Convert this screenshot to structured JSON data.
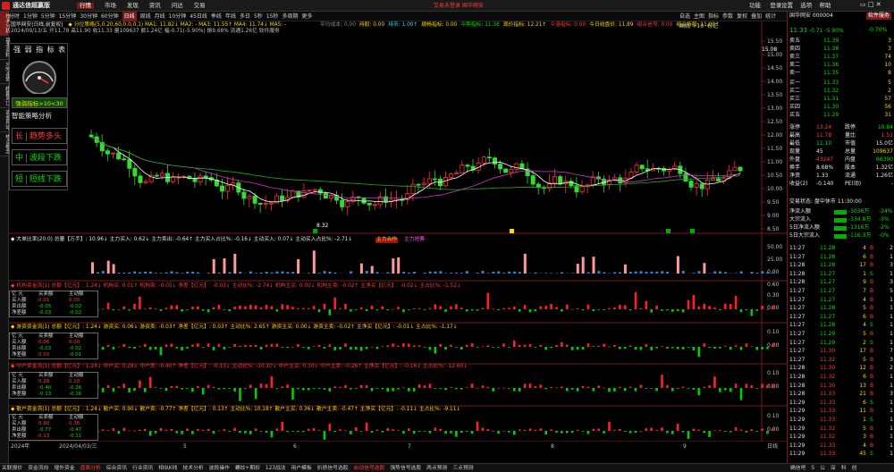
{
  "app": {
    "name": "通达信超赢版",
    "menu": [
      "行情",
      "市场",
      "发现",
      "资讯",
      "问达",
      "交易"
    ],
    "center_notice": "交易未登录  国华网安",
    "right_menu": [
      "功能",
      "登录"
    ],
    "right_menu2": [
      "设置",
      "选项",
      "帮助"
    ]
  },
  "toolbar": [
    "分时",
    "1分钟",
    "5分钟",
    "15分钟",
    "30分钟",
    "60分钟",
    "日线",
    "周线",
    "月线",
    "10分钟",
    "45日线",
    "季线",
    "年线",
    "多日",
    "5秒",
    "15秒",
    "多周期",
    "更多"
  ],
  "toolbar_right": [
    "自选",
    "主图",
    "指标",
    "参数",
    "复权",
    "叠加",
    "统计",
    "画线",
    "F10",
    "标记"
  ],
  "sidebar_tabs": [
    "技术分析",
    "基本资料",
    "分时走势",
    "超赢风口",
    "资金异动",
    "热点概念"
  ],
  "header": {
    "title": "国华网安(日线,前复权)",
    "indicator": "◆ 分位策略(5,0.20,60,0.0,0,1) MA1: 11.82↓ MA2: - MA3: 11.55↑ MA4: 11.74↓ MA5: -",
    "date_line": "2024/09/13/五 开11.78 高11.90 收11.33 量109637 额1.24亿 幅-0.71(-5.90%) 振9.68% 流通1.26亿 软件服务",
    "extra_info": [
      "平均成本: 0.00",
      "持股: 0.00",
      "持币: 1.00↑",
      "顺畅指标: 0.00",
      "今期指标: 11.38",
      "现价指标: 12.21↑",
      "今港指标: 0.00",
      "今日收盘价: 11.89",
      "组合信号: 0.00",
      "组合持股: 11.00↑"
    ]
  },
  "y_axis": [
    "15.50",
    "15.00",
    "14.50",
    "14.00",
    "13.50",
    "13.00",
    "12.50",
    "12.00",
    "11.50",
    "11.00",
    "10.50",
    "10.00",
    "9.50",
    "9.00",
    "8.50"
  ],
  "y_flag": "15.08",
  "low_label": "8.32",
  "strong_panel": {
    "title": "强 弱 指 标 表",
    "condition": "强弱指标>10<30",
    "strategy": "智能策略分析",
    "rows": [
      {
        "tag": "长",
        "text": "趋势多头"
      },
      {
        "tag": "中",
        "text": "波段下跌"
      },
      {
        "tag": "短",
        "text": "短线下跌"
      }
    ]
  },
  "panel1": {
    "text": "◆ 大单比率(20.0) 总量【万手】: 10.96↓ 主力买入: 0.62↓ 主力卖出: -0.64↑ 主力买入占比%: -0.16↓ 主动买入: 0.07↓ 主动买入占比%: -2.71↓",
    "ticks": [
      "50.00",
      "25.00",
      "0.00"
    ],
    "hl": "主力合作",
    "hl2": "主力抢筹"
  },
  "panel2": {
    "text": "◆ 机构资金流(1) 总额【亿元】: 1.24↓ 机构买: 0.01↑ 机构卖: -0.05↓ 净差【亿元】: -0.03↓ 主动比%: -2.74↓ 机构主买: 0.00↓ 机构主卖: -0.02↑ 主净买【亿元】: -0.02↓ 主占比%: -1.52↓",
    "ticks": [
      "0.60",
      "0.30",
      "0.00"
    ],
    "box": [
      [
        "亿 元",
        "买卖额",
        "主动额"
      ],
      [
        "买入额",
        "0.01",
        "0.00"
      ],
      [
        "卖出额",
        "-0.05",
        "-0.02"
      ],
      [
        "净差额",
        "-0.03",
        "-0.02"
      ]
    ]
  },
  "panel3": {
    "text": "◆ 游资资金流(1) 总额【亿元】: 1.24↓ 游资买: 0.06↓ 游资卖: -0.03↑ 净差【亿元】: 0.03↑ 主动比%: 2.65↑ 游资主买: 0.00↓ 游资主卖: -0.02↑ 主净买【亿元】: -0.01↓ 主占比%: -1.17↓",
    "ticks": [
      "0.10",
      "0.00"
    ],
    "box": [
      [
        "亿 元",
        "买卖额",
        "主动额"
      ],
      [
        "买入额",
        "0.06",
        "0.00"
      ],
      [
        "卖出额",
        "-0.03",
        "-0.02"
      ],
      [
        "净差额",
        "0.03",
        "-0.01"
      ]
    ]
  },
  "panel4": {
    "text": "◆ 中户资金流(1) 总额【亿元】: 1.24↓ 中户买: 0.28↓ 中户卖: -0.40↑ 净差【亿元】: -0.13↓ 主动比%: -10.10↓ 中户主买: 0.10↓ 中户主卖: -0.26↑ 主净买【亿元】: -0.16↓ 主占比%: -12.60↓",
    "ticks": [
      "0.10",
      "0.00"
    ],
    "box": [
      [
        "亿 元",
        "买卖额",
        "主动额"
      ],
      [
        "买入额",
        "0.28",
        "0.10"
      ],
      [
        "卖出额",
        "-0.40",
        "-0.26"
      ],
      [
        "净差额",
        "-0.13",
        "-0.16"
      ]
    ]
  },
  "panel5": {
    "text": "◆ 散户资金流(1) 总额【亿元】: 1.24↓ 散户买: 0.90↓ 散户卖: -0.77↑ 净差【亿元】: 0.13↑ 主动比%: 10.18↑ 散户主买: 0.36↓ 散户主卖: -0.47↑ 主净买【亿元】: -0.11↓ 主占比%: -9.11↓",
    "ticks": [
      "0.10",
      "0.00"
    ],
    "box": [
      [
        "亿 元",
        "买卖额",
        "主动额"
      ],
      [
        "买入额",
        "0.90",
        "0.36"
      ],
      [
        "卖出额",
        "-0.77",
        "-0.47"
      ],
      [
        "净差额",
        "0.13",
        "-0.11"
      ]
    ]
  },
  "date_axis": [
    "2024年",
    "2024/04/03/三",
    "5",
    "6",
    "7",
    "8",
    "9"
  ],
  "date_axis_right": "日线",
  "quote": {
    "title": "国华网安 000004",
    "side_btn": "软件服务",
    "price": "11.33",
    "change": "-0.71",
    "pct": "-5.90%",
    "ratio": "-0.70%",
    "sells": [
      {
        "l": "卖五",
        "p": "11.39",
        "v": "3"
      },
      {
        "l": "卖四",
        "p": "11.38",
        "v": "3"
      },
      {
        "l": "卖三",
        "p": "11.37",
        "v": "74"
      },
      {
        "l": "卖二",
        "p": "11.36",
        "v": "10"
      },
      {
        "l": "卖一",
        "p": "11.35",
        "v": "8"
      }
    ],
    "buys": [
      {
        "l": "买一",
        "p": "11.33",
        "v": "5"
      },
      {
        "l": "买二",
        "p": "11.32",
        "v": "2"
      },
      {
        "l": "买三",
        "p": "11.31",
        "v": "57"
      },
      {
        "l": "买四",
        "p": "11.30",
        "v": "56"
      },
      {
        "l": "买五",
        "p": "11.29",
        "v": "31"
      }
    ],
    "stats": [
      [
        "涨停",
        "13.24",
        "跌停",
        "10.84"
      ],
      [
        "最高",
        "11.78",
        "量比",
        "1.51"
      ],
      [
        "最低",
        "11.10",
        "市值",
        "15.0亿"
      ],
      [
        "现量",
        "45",
        "总量",
        "109637"
      ],
      [
        "外盘",
        "43247",
        "内盘",
        "66390"
      ],
      [
        "换手",
        "8.68%",
        "股本",
        "1.32亿"
      ],
      [
        "净资",
        "1.33",
        "流通",
        "1.26亿"
      ],
      [
        "收益(2)",
        "-0.140",
        "PE(动)",
        "-"
      ]
    ],
    "trade_status": "交易状态: 盘中休市 11:30:00",
    "flows": [
      {
        "l": "净流入额",
        "v": "-3036万",
        "p": "-24%"
      },
      {
        "l": "大宗流入",
        "v": "-334.8万",
        "p": "-3%"
      },
      {
        "l": "5日净流入额",
        "v": "-1316万",
        "p": "-2%"
      },
      {
        "l": "5日大宗流入",
        "v": "-116.3万",
        "p": "-0%"
      }
    ],
    "ticks": [
      [
        "11:27",
        "11.28",
        "4",
        "B",
        "2"
      ],
      [
        "11:27",
        "11.28",
        "6",
        "B",
        "1"
      ],
      [
        "11:28",
        "11.28",
        "17",
        "B",
        "3"
      ],
      [
        "11:28",
        "11.27",
        "1",
        "S",
        "1"
      ],
      [
        "11:28",
        "11.27",
        "9",
        "B",
        "3"
      ],
      [
        "11:27",
        "11.27",
        "7",
        "B",
        "5"
      ],
      [
        "11:27",
        "11.27",
        "4",
        "B",
        "1"
      ],
      [
        "11:27",
        "11.28",
        "5",
        "B",
        "1"
      ],
      [
        "11:27",
        "11.27",
        "6",
        "B",
        "1"
      ],
      [
        "11:27",
        "11.28",
        "4",
        "S",
        "1"
      ],
      [
        "11:27",
        "11.29",
        "5",
        "B",
        "1"
      ],
      [
        "11:27",
        "11.29",
        "2",
        "S",
        "1"
      ],
      [
        "11:27",
        "11.30",
        "17",
        "B",
        "7"
      ],
      [
        "11:27",
        "11.32",
        "5",
        "B",
        "3"
      ],
      [
        "11:28",
        "11.30",
        "12",
        "B",
        "2"
      ],
      [
        "11:28",
        "11.32",
        "6",
        "B",
        "1"
      ],
      [
        "11:28",
        "11.30",
        "13",
        "B",
        "1"
      ],
      [
        "11:28",
        "11.33",
        "21",
        "B",
        "3"
      ],
      [
        "11:29",
        "11.33",
        "6",
        "S",
        "1"
      ],
      [
        "11:29",
        "11.33",
        "11",
        "B",
        "1"
      ],
      [
        "11:29",
        "11.33",
        "1",
        "S",
        "1"
      ],
      [
        "11:29",
        "11.32",
        "5",
        "B",
        "1"
      ],
      [
        "11:29",
        "11.32",
        "3",
        "B",
        "1"
      ],
      [
        "11:29",
        "11.33",
        "4",
        "B",
        "1"
      ],
      [
        "11:29",
        "11.33",
        "45",
        "S",
        "1"
      ]
    ]
  },
  "statusbar": [
    "关联报价",
    "资金流向",
    "增外资金",
    "盘面分析",
    "综合资讯",
    "行业资讯",
    "相似K线",
    "技术分析",
    "波段操作",
    "螺纹+期权",
    "123战法",
    "用户模板",
    "扒债信号选股",
    "启动信号选股",
    "强势信号选股",
    "两点预测",
    "三点预测"
  ],
  "statusbar_right": [
    "确信吧",
    "S",
    "公",
    "深",
    "科",
    "创"
  ]
}
